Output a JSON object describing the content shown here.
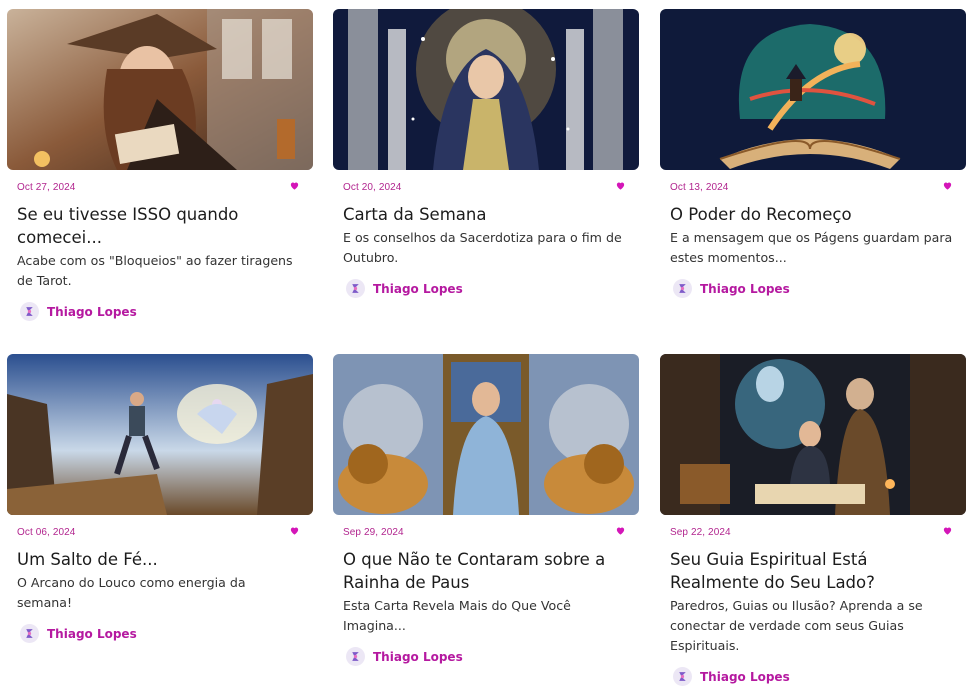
{
  "posts": [
    {
      "date": "Oct 27, 2024",
      "title": "Se eu tivesse ISSO quando comecei...",
      "excerpt": "Acabe com os \"Bloqueios\" ao fazer tiragens de Tarot.",
      "author": "Thiago Lopes",
      "image": "witch-with-tarot-cards"
    },
    {
      "date": "Oct 20, 2024",
      "title": "Carta da Semana",
      "excerpt": "E os conselhos da Sacerdotiza para o fim de Outubro.",
      "author": "Thiago Lopes",
      "image": "high-priestess"
    },
    {
      "date": "Oct 13, 2024",
      "title": "O Poder do Recomeço",
      "excerpt": "E a mensagem que os Págens guardam para estes momentos...",
      "author": "Thiago Lopes",
      "image": "wanderer-on-open-book"
    },
    {
      "date": "Oct 06, 2024",
      "title": "Um Salto de Fé...",
      "excerpt": "O Arcano do Louco como energia da semana!",
      "author": "Thiago Lopes",
      "image": "man-leaping-toward-angel"
    },
    {
      "date": "Sep 29, 2024",
      "title": "O que Não te Contaram sobre a Rainha de Paus",
      "excerpt": "Esta Carta Revela Mais do Que Você Imagina...",
      "author": "Thiago Lopes",
      "image": "queen-on-throne-with-lions"
    },
    {
      "date": "Sep 22, 2024",
      "title": "Seu Guia Espiritual Está Realmente do Seu Lado?",
      "excerpt": "Paredros, Guias ou Ilusão? Aprenda a se conectar de verdade com seus Guias Espirituais.",
      "author": "Thiago Lopes",
      "image": "spirit-guide-with-scholar"
    }
  ],
  "colors": {
    "accent": "#b519a0",
    "date": "#b2268f",
    "heart": "#d416b8"
  }
}
